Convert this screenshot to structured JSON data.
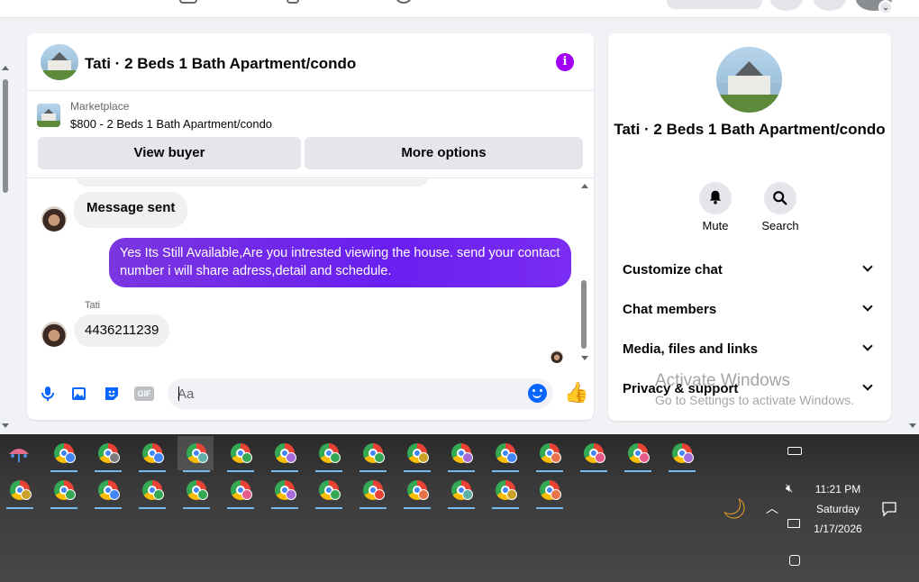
{
  "chat": {
    "title": "Tati · 2 Beds 1 Bath Apartment/condo",
    "marketplace_label": "Marketplace",
    "listing": "$800 - 2 Beds 1 Bath Apartment/condo",
    "view_buyer": "View buyer",
    "more_options": "More options",
    "messages": {
      "sent_notice": "Message sent",
      "outgoing": "Yes Its Still Available,Are you intrested viewing the house. send your contact number i will share adress,detail and schedule.",
      "sender": "Tati",
      "incoming": "4436211239"
    },
    "composer": {
      "placeholder": "Aa",
      "icons": [
        "microphone-icon",
        "photo-icon",
        "sticker-icon",
        "gif-icon",
        "emoji-icon",
        "thumbs-up-icon"
      ],
      "gif_label": "GIF"
    },
    "accent_color": "#a100f2",
    "bubble_color": "#6a1ff0"
  },
  "info_panel": {
    "title": "Tati · 2 Beds 1 Bath Apartment/condo",
    "mute": "Mute",
    "search": "Search",
    "sections": [
      "Customize chat",
      "Chat members",
      "Media, files and links",
      "Privacy & support"
    ]
  },
  "watermark": {
    "line1": "Activate Windows",
    "line2": "Go to Settings to activate Windows."
  },
  "taskbar": {
    "time": "11:21 PM",
    "day": "Saturday",
    "date": "1/17/2026"
  }
}
